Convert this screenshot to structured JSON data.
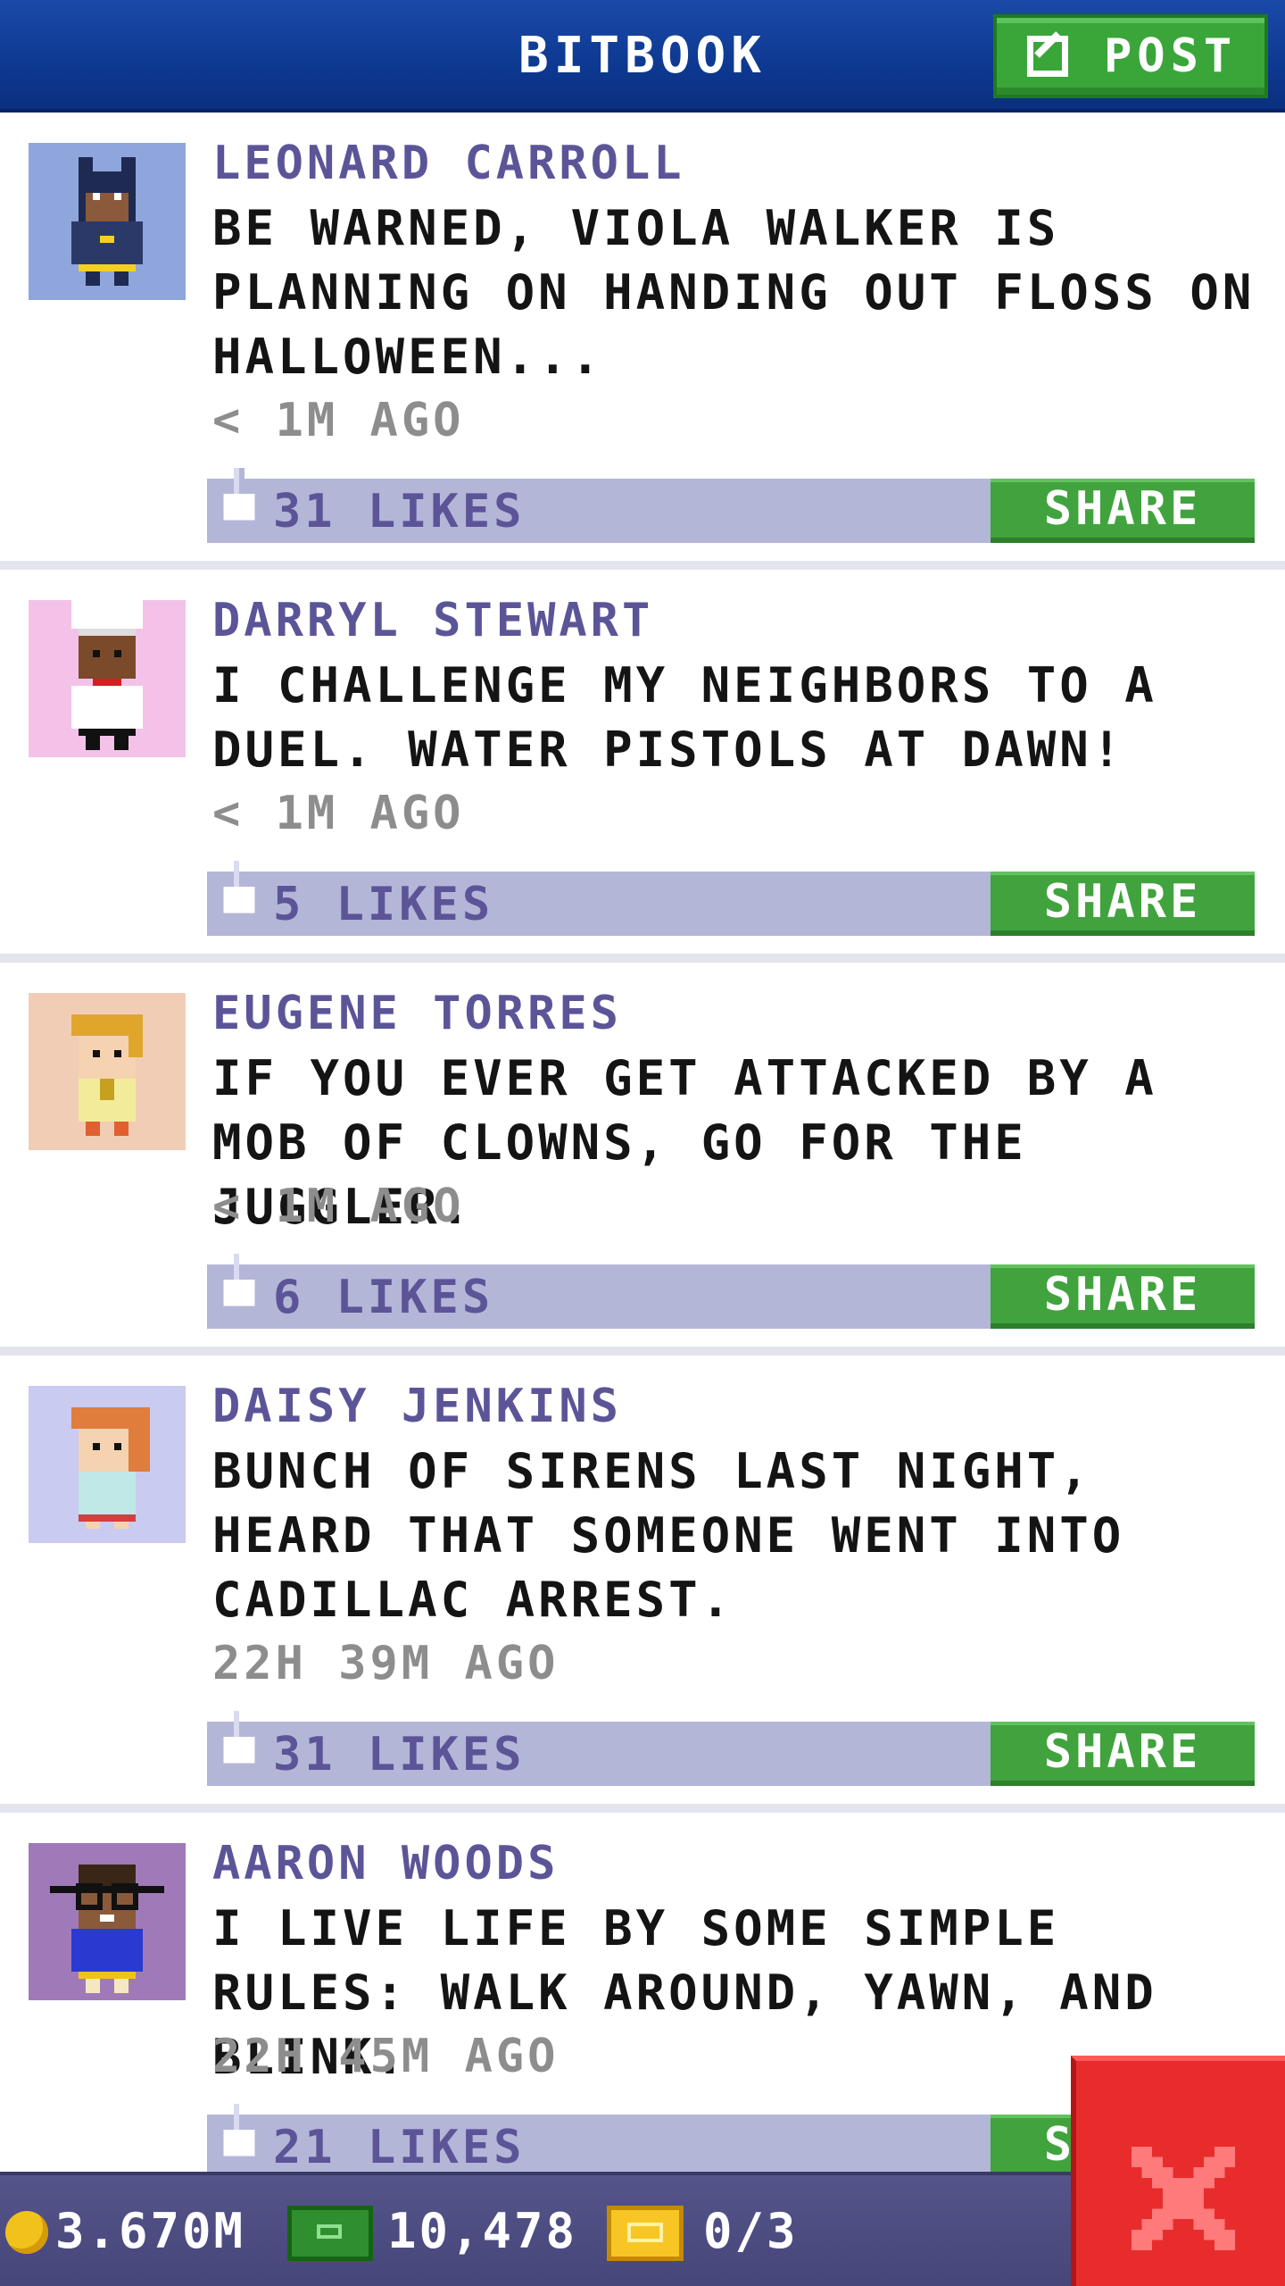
{
  "header": {
    "title": "BITBOOK",
    "post_label": "POST"
  },
  "posts": [
    {
      "author": "LEONARD CARROLL",
      "text": "BE WARNED, VIOLA WALKER IS PLANNING ON HANDING OUT FLOSS ON HALLOWEEN...",
      "time": "< 1M AGO",
      "likes": "31 LIKES",
      "share_label": "SHARE",
      "avatar": "batman-costume-avatar",
      "avatar_bg": "#8fa6dc"
    },
    {
      "author": "DARRYL STEWART",
      "text": "I CHALLENGE MY NEIGHBORS TO A DUEL. WATER PISTOLS AT DAWN!",
      "time": "< 1M AGO",
      "likes": "5 LIKES",
      "share_label": "SHARE",
      "avatar": "chef-avatar",
      "avatar_bg": "#f4c2e8"
    },
    {
      "author": "EUGENE TORRES",
      "text": "IF YOU EVER GET ATTACKED BY A MOB OF CLOWNS, GO FOR THE JUGGLER.",
      "time": "< 1M AGO",
      "likes": "6 LIKES",
      "share_label": "SHARE",
      "avatar": "blond-person-avatar",
      "avatar_bg": "#f2cdb6"
    },
    {
      "author": "DAISY JENKINS",
      "text": "BUNCH OF SIRENS LAST NIGHT, HEARD THAT SOMEONE WENT INTO CADILLAC ARREST.",
      "time": "22H 39M AGO",
      "likes": "31 LIKES",
      "share_label": "SHARE",
      "avatar": "redhead-person-avatar",
      "avatar_bg": "#c9cbf0"
    },
    {
      "author": "AARON WOODS",
      "text": "I LIVE LIFE BY SOME SIMPLE RULES: WALK AROUND, YAWN, AND BLINK.",
      "time": "22H 45M AGO",
      "likes": "21 LIKES",
      "share_label": "SHARE",
      "avatar": "glasses-person-avatar",
      "avatar_bg": "#a07ab8"
    }
  ],
  "status_bar": {
    "coins": "3.670M",
    "bux": "10,478",
    "tickets": "0/3"
  },
  "colors": {
    "header_blue": "#0e3a93",
    "accent_green": "#41a33e",
    "likes_bar": "#b4b6d8",
    "author_purple": "#5b5598",
    "close_red": "#e82c2c"
  }
}
